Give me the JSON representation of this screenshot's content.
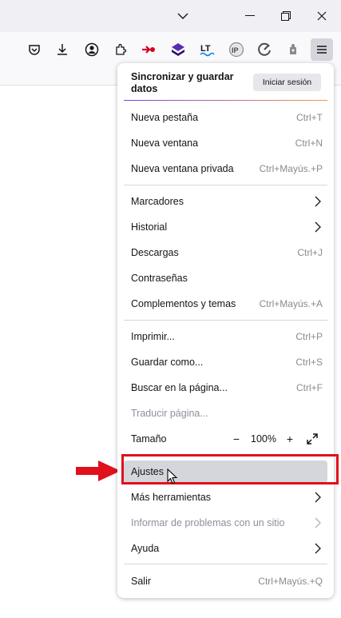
{
  "colors": {
    "accent_red": "#e0101c",
    "menu_hover": "#d5d5dc",
    "shortcut_gray": "#8a8a90"
  },
  "toolbar_icons": [
    "pocket-icon",
    "download-icon",
    "account-icon",
    "extensions-icon",
    "extension-red-icon",
    "extension-purple-icon",
    "extension-languagetool-icon",
    "extension-ip-icon",
    "extension-gauge-icon",
    "extension-puzzle-gray-icon",
    "hamburger-menu-icon"
  ],
  "extensions": {
    "languagetool": "LT",
    "ip": "IP"
  },
  "sync": {
    "title": "Sincronizar y guardar datos",
    "signin_label": "Iniciar sesión"
  },
  "menu": {
    "nueva_pestana": {
      "label": "Nueva pestaña",
      "shortcut": "Ctrl+T"
    },
    "nueva_ventana": {
      "label": "Nueva ventana",
      "shortcut": "Ctrl+N"
    },
    "nueva_ventana_privada": {
      "label": "Nueva ventana privada",
      "shortcut": "Ctrl+Mayús.+P"
    },
    "marcadores": {
      "label": "Marcadores"
    },
    "historial": {
      "label": "Historial"
    },
    "descargas": {
      "label": "Descargas",
      "shortcut": "Ctrl+J"
    },
    "contrasenas": {
      "label": "Contraseñas"
    },
    "complementos": {
      "label": "Complementos y temas",
      "shortcut": "Ctrl+Mayús.+A"
    },
    "imprimir": {
      "label": "Imprimir...",
      "shortcut": "Ctrl+P"
    },
    "guardar_como": {
      "label": "Guardar como...",
      "shortcut": "Ctrl+S"
    },
    "buscar": {
      "label": "Buscar en la página...",
      "shortcut": "Ctrl+F"
    },
    "traducir": {
      "label": "Traducir página..."
    },
    "tamano": {
      "label": "Tamaño",
      "zoom_out": "−",
      "zoom_value": "100%",
      "zoom_in": "+"
    },
    "ajustes": {
      "label": "Ajustes"
    },
    "mas_herramientas": {
      "label": "Más herramientas"
    },
    "informar": {
      "label": "Informar de problemas con un sitio"
    },
    "ayuda": {
      "label": "Ayuda"
    },
    "salir": {
      "label": "Salir",
      "shortcut": "Ctrl+Mayús.+Q"
    }
  }
}
